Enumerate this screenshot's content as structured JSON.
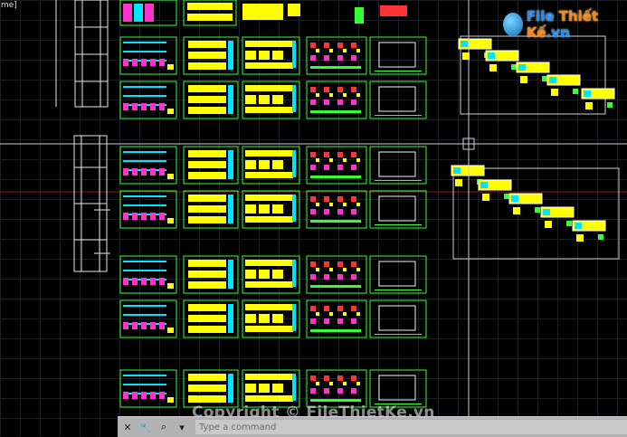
{
  "viewport_label": "me]",
  "logo": {
    "brand": "File",
    "accent": "Thiết Kế",
    "tld": ".vn"
  },
  "watermark": "Copyright © FileThietKe.vn",
  "command_line": {
    "placeholder": "Type a command",
    "icons": [
      "close-icon",
      "wrench-icon",
      "search-icon",
      "dropdown-arrow-icon"
    ]
  },
  "colors": {
    "background": "#000000",
    "frame": "#33ff33",
    "fill_yellow": "#ffff00",
    "fill_cyan": "#00e5ff",
    "fill_magenta": "#ff33cc",
    "crosshair": "#d0d0d0",
    "axis_red": "#8b1a1a",
    "command_bar": "#b3b3b3"
  },
  "sheet_columns": [
    "schedule",
    "elevation",
    "section",
    "detail",
    "frame"
  ]
}
